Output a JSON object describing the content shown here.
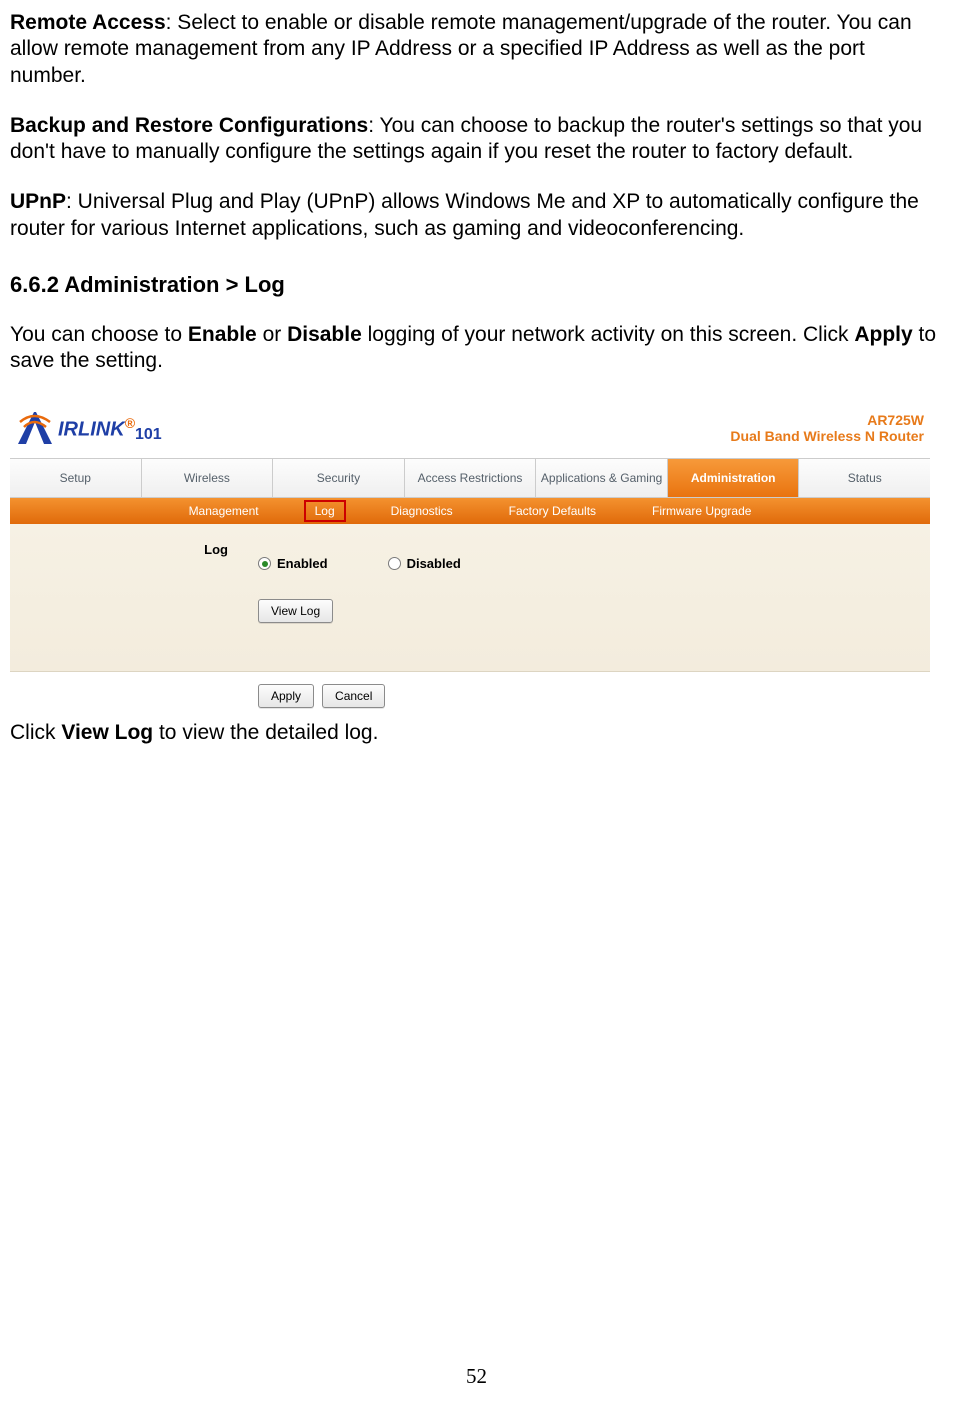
{
  "paragraphs": {
    "remote_access_label": "Remote Access",
    "remote_access_text": ": Select to enable or disable remote management/upgrade of the router. You can allow remote management from any IP Address or a specified IP Address as well as the port number.",
    "backup_label": "Backup and Restore Configurations",
    "backup_text": ": You can choose to backup the router's settings so that you don't have to manually configure the settings again if you reset the router to factory default.",
    "upnp_label": "UPnP",
    "upnp_text": ": Universal Plug and Play (UPnP) allows Windows Me and XP to automatically configure the router for various Internet applications, such as gaming and videoconferencing."
  },
  "section_heading": "6.6.2 Administration > Log",
  "intro": {
    "pre": "You can choose to ",
    "enable": "Enable",
    "mid1": " or ",
    "disable": "Disable",
    "mid2": " logging of your network activity on this screen. Click ",
    "apply": "Apply",
    "post": " to save the setting."
  },
  "router": {
    "brand_name": "IRLINK",
    "brand_suffix": "101",
    "model": "AR725W",
    "model_sub": "Dual Band Wireless N Router",
    "tabs": [
      "Setup",
      "Wireless",
      "Security",
      "Access Restrictions",
      "Applications & Gaming",
      "Administration",
      "Status"
    ],
    "active_tab_index": 5,
    "subnav": [
      "Management",
      "Log",
      "Diagnostics",
      "Factory Defaults",
      "Firmware Upgrade"
    ],
    "selected_subnav_index": 1,
    "panel_label": "Log",
    "radio_enabled": "Enabled",
    "radio_disabled": "Disabled",
    "radio_checked": "enabled",
    "view_log_btn": "View Log",
    "apply_btn": "Apply",
    "cancel_btn": "Cancel"
  },
  "closing": {
    "pre": "Click ",
    "view_log": "View Log",
    "post": " to view the detailed log."
  },
  "page_number": "52"
}
